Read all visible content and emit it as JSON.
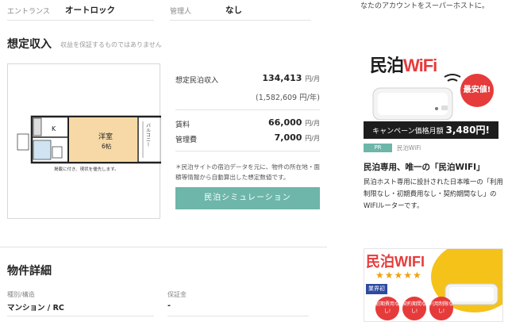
{
  "top_row": {
    "label1": "エントランス",
    "value1": "オートロック",
    "label2": "管理人",
    "value2": "なし"
  },
  "income": {
    "title": "想定収入",
    "note": "収益を保証するものではありません",
    "estimate_label": "想定民泊収入",
    "estimate_value": "134,413",
    "estimate_unit": "円/月",
    "annual_value": "(1,582,609 円/年)",
    "rent_label": "賃料",
    "rent_value": "66,000",
    "rent_unit": "円/月",
    "mgmt_label": "管理費",
    "mgmt_value": "7,000",
    "mgmt_unit": "円/月",
    "disclaimer": "＊民泊サイトの宿泊データを元に、物件の所在地・面積等情報から自動算出した想定数値です。",
    "sim_button": "民泊シミュレーション"
  },
  "floorplan": {
    "room_label": "洋室",
    "room_size": "6帖",
    "kitchen_label": "K",
    "balcony_label": "バルコニー",
    "caption": "掲載に付き、現状を優先します。"
  },
  "details": {
    "title": "物件詳細",
    "type_label": "種別/構造",
    "type_value": "マンション / RC",
    "deposit_label": "保証金",
    "deposit_value": "-"
  },
  "sidebar": {
    "top_text": "なたのアカウントをスーパーホストに。",
    "ad1": {
      "brand_main": "民泊",
      "brand_accent": "WiFi",
      "badge": "最安値!",
      "banner_prefix": "キャンペーン価格月額",
      "banner_price": "3,480円!"
    },
    "pr_label": "PR",
    "pr_source": "民泊WiFi",
    "ad_title": "民泊専用、唯一の「民泊WIFI」",
    "ad_desc": "民泊ホスト専用に設計された日本唯一の「利用制限なし・初期費用なし・契約期間なし」のWIFIルーターです。",
    "ad2": {
      "brand": "民泊WIFI",
      "stars": "★★★★★",
      "tag": "業界初",
      "c1": "初期費用なし!",
      "c2": "契約期間なし!",
      "c3": "利用制限なし!"
    }
  },
  "colors": {
    "accent": "#6db6a9",
    "red": "#e63b3b"
  }
}
